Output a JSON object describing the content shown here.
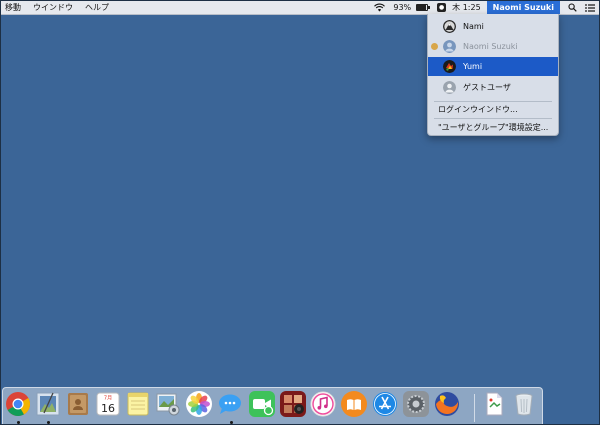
{
  "menubar": {
    "items": [
      "移動",
      "ウインドウ",
      "ヘルプ"
    ],
    "battery_percent": "93%",
    "battery_level": 0.93,
    "clock": "木 1:25",
    "current_user": "Naomi Suzuki",
    "icons": [
      "wifi-icon",
      "fast-user-switch-icon",
      "spotlight-icon",
      "notification-center-icon"
    ]
  },
  "user_menu": {
    "users": [
      {
        "name": "Nami",
        "state": "normal"
      },
      {
        "name": "Naomi Suzuki",
        "state": "current-disabled"
      },
      {
        "name": "Yumi",
        "state": "selected"
      },
      {
        "name": "ゲストユーザ",
        "state": "normal"
      }
    ],
    "login_window": "ログインウインドウ...",
    "users_groups_prefs": "\"ユーザとグループ\"環境設定..."
  },
  "dock": {
    "apps": [
      "chrome-icon",
      "preview-icon",
      "contacts-icon",
      "calendar-icon",
      "notes-icon",
      "image-capture-icon",
      "photos-icon",
      "messages-icon",
      "facetime-icon",
      "photo-booth-icon",
      "itunes-icon",
      "ibooks-icon",
      "app-store-icon",
      "system-preferences-icon",
      "firefox-icon",
      "document-icon",
      "trash-icon"
    ],
    "calendar_month": "7月",
    "calendar_day": "16",
    "colors": {
      "chrome_red": "#db4437",
      "firefox_orange": "#f37321",
      "appstore_blue": "#1e88e5"
    }
  },
  "colors": {
    "desktop": "#3b6597",
    "menubar": "#e6e9ee",
    "accent": "#1c5ac7"
  }
}
